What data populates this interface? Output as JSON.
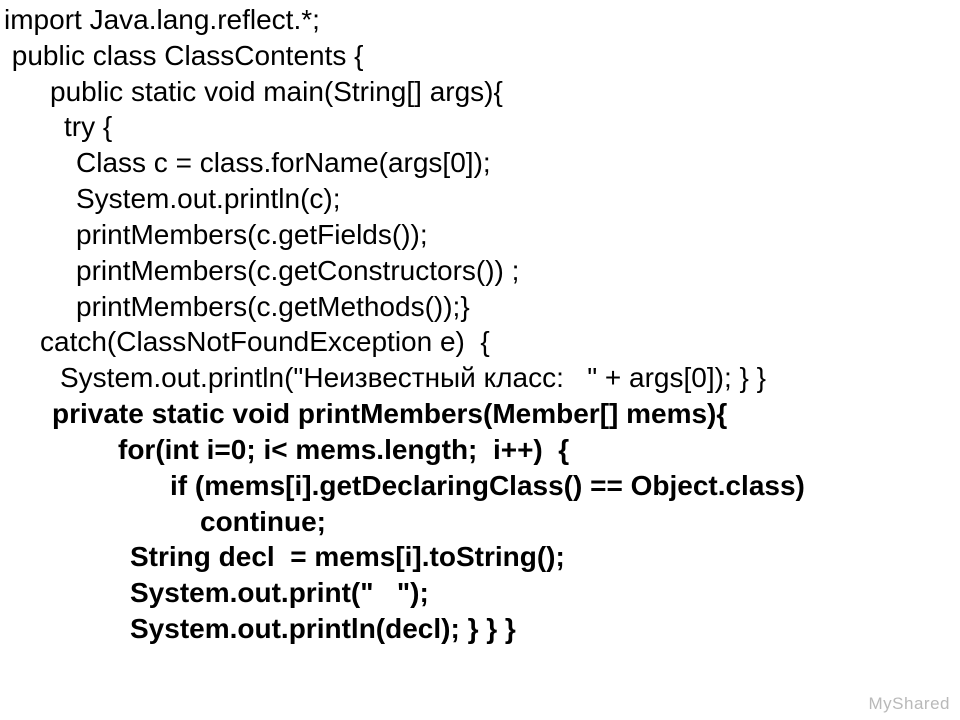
{
  "code": {
    "l1": "import Java.lang.reflect.*;",
    "l2": " public class ClassContents {",
    "l3": "public static void main(String[] args){",
    "l4": "try {",
    "l5": "Class c = class.forName(args[0]);",
    "l6": "System.out.println(c);",
    "l7": "printMembers(c.getFields());",
    "l8": "printMembers(c.getConstructors()) ;",
    "l9": "printMembers(c.getMethods());}",
    "l10": "catch(ClassNotFoundException e)  {",
    "l11": "System.out.println(\"Неизвестный класс:   \" + args[0]); } }",
    "l12": "private static void printMembers(Member[] mems){",
    "l13": "for(int i=0; i< mems.length;  i++)  {",
    "l14": "if (mems[i].getDeclaringClass() == Object.class)",
    "l15": "continue;",
    "l16": "String decl  = mems[i].toString();",
    "l17": "System.out.print(\"   \");",
    "l18": "System.out.println(decl); } } }"
  },
  "watermark": "MyShared"
}
